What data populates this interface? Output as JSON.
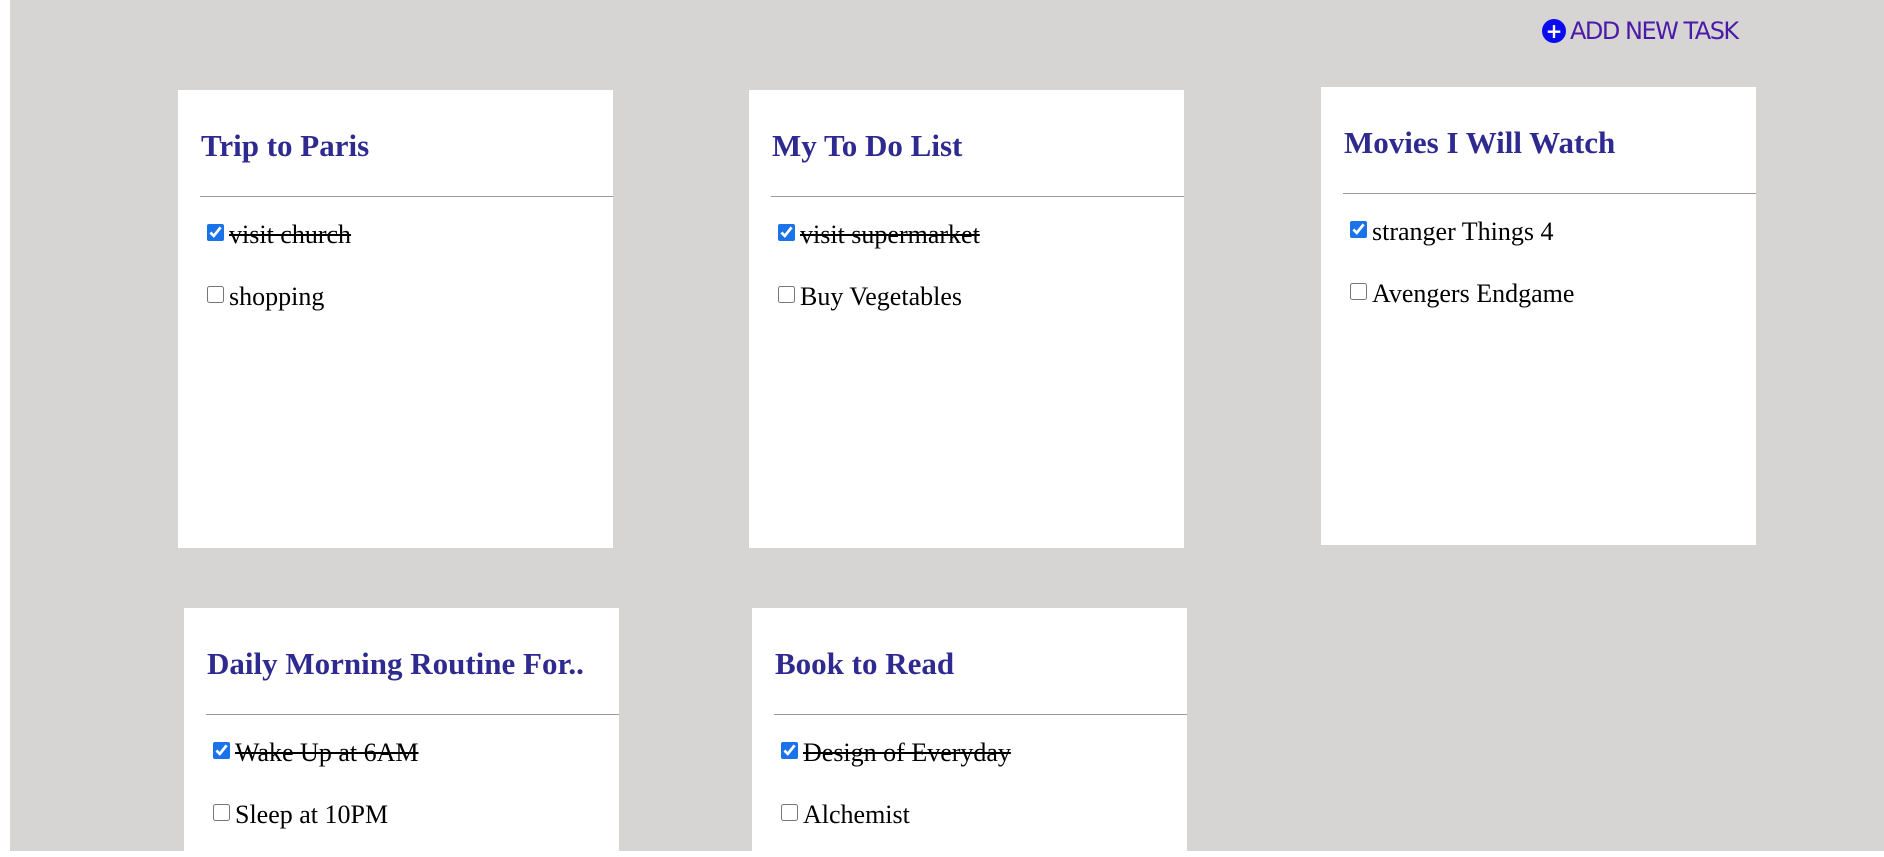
{
  "header": {
    "add_task_label": "ADD NEW TASK",
    "add_task_icon": "plus-circle-icon",
    "accent_color": "#0b0bf0"
  },
  "lists": [
    {
      "title": "Trip to Paris",
      "items": [
        {
          "text": "visit church",
          "done": true
        },
        {
          "text": "shopping",
          "done": false
        }
      ]
    },
    {
      "title": "My To Do List",
      "items": [
        {
          "text": "visit supermarket",
          "done": true
        },
        {
          "text": "Buy Vegetables",
          "done": false
        }
      ]
    },
    {
      "title": "Movies I Will Watch",
      "items": [
        {
          "text": "stranger Things 4",
          "done": true
        },
        {
          "text": "Avengers Endgame",
          "done": false
        }
      ]
    },
    {
      "title": "Daily Morning Routine For..",
      "items": [
        {
          "text": "Wake Up at 6AM",
          "done": true
        },
        {
          "text": "Sleep at 10PM",
          "done": false
        }
      ]
    },
    {
      "title": "Book to Read",
      "items": [
        {
          "text": "Design of Everyday",
          "done": true
        },
        {
          "text": "Alchemist",
          "done": false
        }
      ]
    }
  ]
}
